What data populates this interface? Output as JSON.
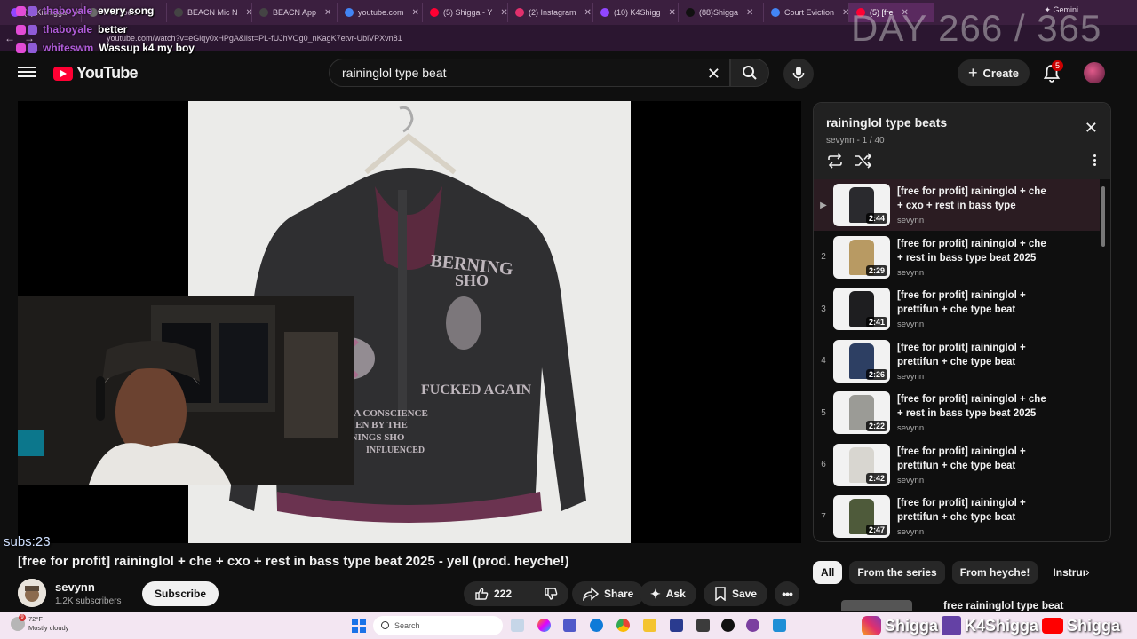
{
  "browser": {
    "tabs": [
      {
        "label": "(1) Kishigga",
        "color": "#9146ff"
      },
      {
        "label": "TRL Tools",
        "color": "#6b6b6b"
      },
      {
        "label": "BEACN Mic N",
        "color": "#444"
      },
      {
        "label": "BEACN App",
        "color": "#444"
      },
      {
        "label": "youtube.com",
        "color": "#4285f4"
      },
      {
        "label": "(5) Shigga - Y",
        "color": "#ff0033"
      },
      {
        "label": "(2) Instagram",
        "color": "#e1306c"
      },
      {
        "label": "(10) K4Shigg",
        "color": "#9146ff"
      },
      {
        "label": "(88)Shigga",
        "color": "#111"
      },
      {
        "label": "Court Eviction",
        "color": "#4285f4"
      },
      {
        "label": "(5) [fre",
        "color": "#ff0033",
        "active": true
      }
    ],
    "gemini_label": "Gemini",
    "url": "youtube.com/watch?v=eGlqy0xHPgA&list=PL-fUJhVOg0_nKagK7etvr-UblVPXvn81"
  },
  "overlay": {
    "chat": [
      {
        "user": "thaboyale",
        "message": "every song"
      },
      {
        "user": "thaboyale",
        "message": "better"
      },
      {
        "user": "whiteswm",
        "message": "Wassup k4 my boy"
      }
    ],
    "day_counter": "DAY 266 / 365",
    "subs": "subs:23"
  },
  "youtube": {
    "logo_text": "YouTube",
    "search_value": "raininglol type beat",
    "create_label": "Create",
    "notifications": "5",
    "video": {
      "title": "[free for profit] raininglol + che + cxo + rest in bass type beat 2025 - yell (prod. heyche!)",
      "channel": "sevynn",
      "subscribers": "1.2K subscribers",
      "subscribe_label": "Subscribe",
      "likes": "222",
      "share_label": "Share",
      "ask_label": "Ask",
      "save_label": "Save",
      "shirt_text": [
        "BERNING",
        "SHO",
        "FUCKED AGAIN",
        "GOT A CONSCIENCE",
        "DRIVEN BY THE",
        "BERNINGS SHO",
        "INFLUENCED"
      ]
    },
    "playlist": {
      "title": "raininglol type beats",
      "position": "sevynn - 1 / 40",
      "items": [
        {
          "index": "▶",
          "title": "[free for profit] raininglol + che + cxo + rest in bass type beat...",
          "channel": "sevynn",
          "duration": "2:44",
          "current": true
        },
        {
          "index": "2",
          "title": "[free for profit] raininglol + che + rest in bass type beat 2025 -...",
          "channel": "sevynn",
          "duration": "2:29"
        },
        {
          "index": "3",
          "title": "[free for profit] raininglol + prettifun + che type beat 2025...",
          "channel": "sevynn",
          "duration": "2:41"
        },
        {
          "index": "4",
          "title": "[free for profit] raininglol + prettifun + che type beat 2025...",
          "channel": "sevynn",
          "duration": "2:26"
        },
        {
          "index": "5",
          "title": "[free for profit] raininglol + che + rest in bass type beat 2025 -...",
          "channel": "sevynn",
          "duration": "2:22"
        },
        {
          "index": "6",
          "title": "[free for profit] raininglol + prettifun + che type beat 2025...",
          "channel": "sevynn",
          "duration": "2:42"
        },
        {
          "index": "7",
          "title": "[free for profit] raininglol + prettifun + che type beat 2025...",
          "channel": "sevynn",
          "duration": "2:47"
        }
      ]
    },
    "chips": [
      {
        "label": "All",
        "active": true
      },
      {
        "label": "From the series"
      },
      {
        "label": "From heyche!"
      },
      {
        "label": "Instrum"
      }
    ],
    "next_title": "free raininglol type beat"
  },
  "taskbar": {
    "temperature": "72°F",
    "weather": "Mostly cloudy",
    "weather_badge": "9",
    "search_placeholder": "Search",
    "socials": [
      "Shigga",
      "K4Shigga",
      "Shigga"
    ]
  },
  "colors": {
    "yt_red": "#ff0033",
    "bg": "#0f0f0f",
    "chat_user": "#b05bd8",
    "browser_frame": "#3b1f3f"
  }
}
